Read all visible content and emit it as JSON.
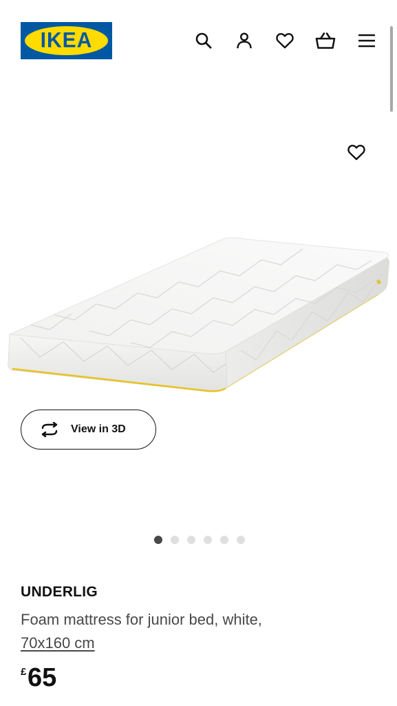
{
  "header": {
    "logo_text": "IKEA",
    "logo_reg": "®",
    "brand_colors": {
      "blue": "#0058a3",
      "yellow": "#ffdb00"
    },
    "icons": [
      "search-icon",
      "user-icon",
      "heart-icon",
      "basket-icon",
      "menu-icon"
    ]
  },
  "gallery": {
    "favourite_icon": "heart-icon",
    "view_3d_label": "View in 3D",
    "view_3d_icon": "rotate-icon",
    "image_count": 6,
    "active_image": 1
  },
  "product": {
    "name": "UNDERLIG",
    "description": "Foam mattress for junior bed, white,",
    "size": "70x160 cm",
    "currency_symbol": "£",
    "price": "65"
  }
}
